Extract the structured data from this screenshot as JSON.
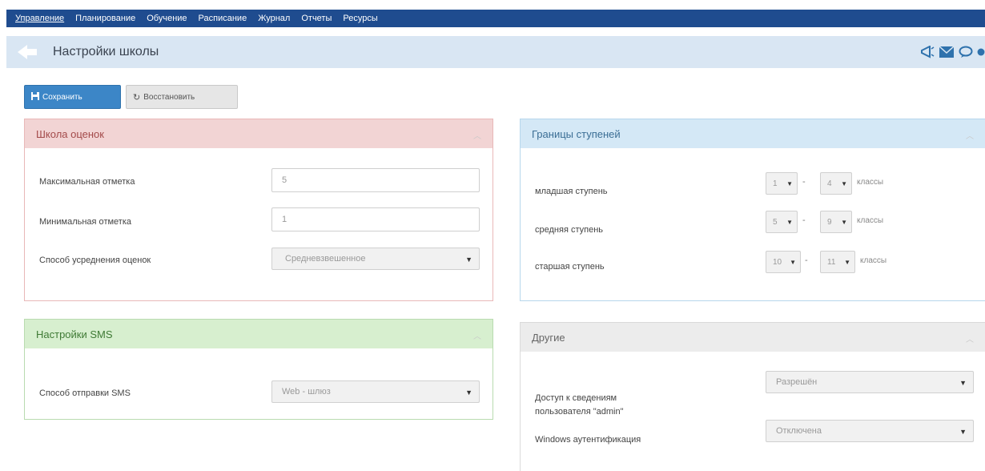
{
  "nav": {
    "items": [
      "Управление",
      "Планирование",
      "Обучение",
      "Расписание",
      "Журнал",
      "Отчеты",
      "Ресурсы"
    ]
  },
  "header": {
    "title": "Настройки школы"
  },
  "toolbar": {
    "save_label": "Сохранить",
    "restore_label": "Восстановить"
  },
  "grades_panel": {
    "title": "Школа оценок",
    "max_label": "Максимальная отметка",
    "max_value": "5",
    "min_label": "Минимальная отметка",
    "min_value": "1",
    "avg_label": "Способ усреднения оценок",
    "avg_value": "Средневзвешенное"
  },
  "levels_panel": {
    "title": "Границы ступеней",
    "suffix": "классы",
    "rows": [
      {
        "label": "младшая ступень",
        "from": "1",
        "to": "4"
      },
      {
        "label": "средняя ступень",
        "from": "5",
        "to": "9"
      },
      {
        "label": "старшая ступень",
        "from": "10",
        "to": "11"
      }
    ]
  },
  "sms_panel": {
    "title": "Настройки SMS",
    "method_label": "Способ отправки SMS",
    "method_value": "Web - шлюз"
  },
  "other_panel": {
    "title": "Другие",
    "access_label_line1": "Доступ к сведениям",
    "access_label_line2": "пользователя \"admin\"",
    "access_value": "Разрешён",
    "windows_label": "Windows аутентификация",
    "windows_value": "Отключена"
  },
  "colors": {
    "nav_bg": "#1f4c8f",
    "header_bg": "#d9e6f3",
    "primary_btn": "#3c86c7"
  }
}
